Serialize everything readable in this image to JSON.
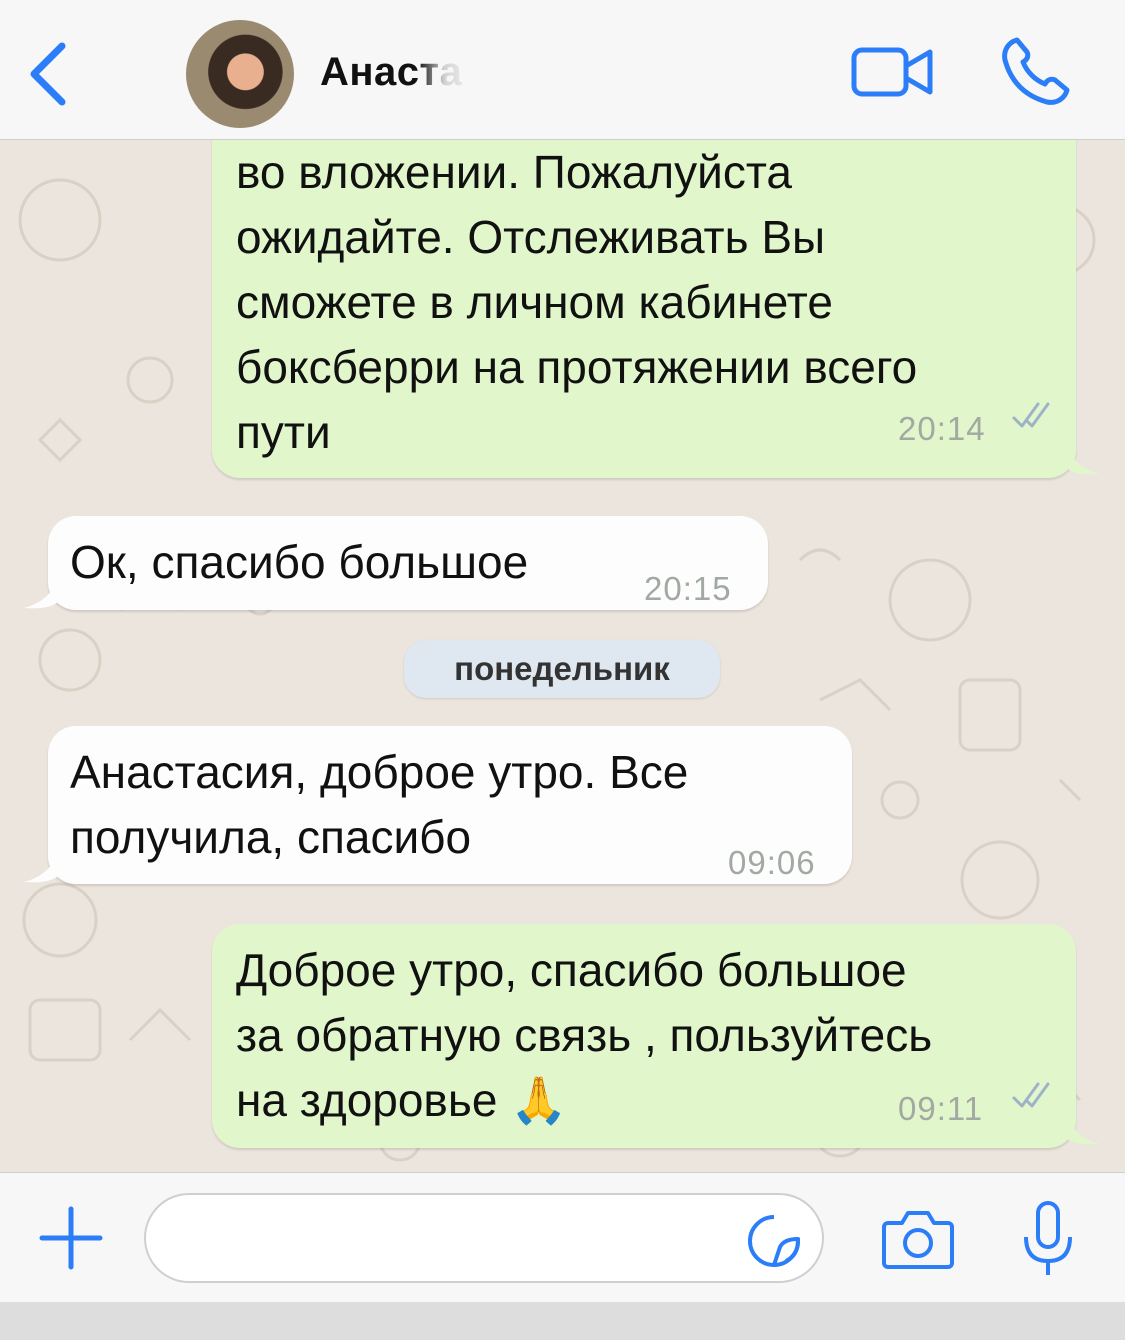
{
  "header": {
    "contact_name": "Анаста",
    "back_icon": "chevron-left-icon",
    "video_icon": "video-camera-icon",
    "call_icon": "phone-icon",
    "accent_color": "#2c7ef8"
  },
  "messages": [
    {
      "direction": "outgoing",
      "text": "во вложении. Пожалуйста\nожидайте. Отслеживать Вы\nсможете в личном кабинете\nбоксберри на протяжении всего\nпути",
      "time": "20:14",
      "status_icon": "double-check-icon"
    },
    {
      "direction": "incoming",
      "text": "Ок, спасибо большое",
      "time": "20:15"
    },
    {
      "direction": "incoming",
      "text": "Анастасия, доброе утро. Все\nполучила, спасибо",
      "time": "09:06"
    },
    {
      "direction": "outgoing",
      "text": "Доброе утро, спасибо большое\nза обратную связь , пользуйтесь\nна здоровье 🙏",
      "time": "09:11",
      "status_icon": "double-check-icon"
    }
  ],
  "date_separator": "понедельник",
  "input_bar": {
    "plus_icon": "plus-icon",
    "message_value": "",
    "sticker_icon": "sticker-icon",
    "camera_icon": "camera-icon",
    "mic_icon": "microphone-icon"
  },
  "colors": {
    "outgoing_bubble": "#e1f7cb",
    "incoming_bubble": "#fdfdfd",
    "chat_background": "#ece5dd",
    "check_color": "#9fb3c8"
  }
}
